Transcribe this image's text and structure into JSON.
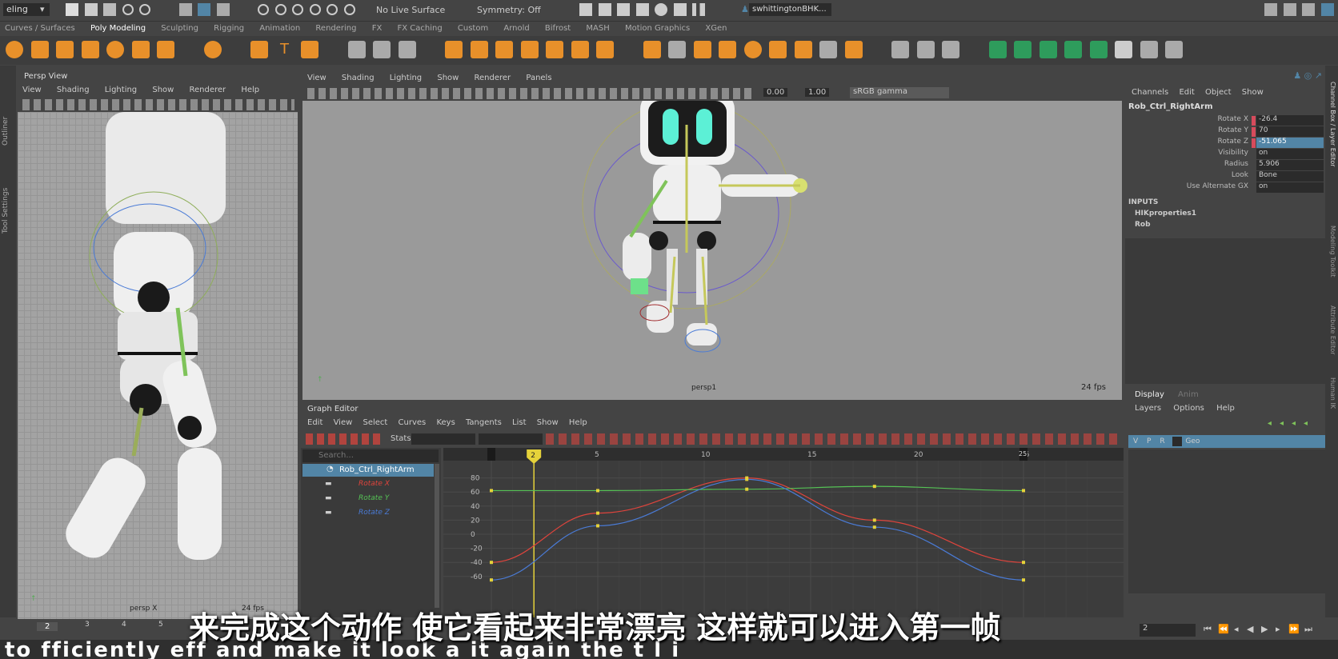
{
  "status_line": {
    "mode": "eling",
    "live_surface": "No Live Surface",
    "symmetry": "Symmetry: Off",
    "user": "swhittingtonBHK..."
  },
  "shelf_tabs": [
    "Curves / Surfaces",
    "Poly Modeling",
    "Sculpting",
    "Rigging",
    "Animation",
    "Rendering",
    "FX",
    "FX Caching",
    "Custom",
    "Arnold",
    "Bifrost",
    "MASH",
    "Motion Graphics",
    "XGen"
  ],
  "left_panel": {
    "title": "Persp View",
    "menu": [
      "View",
      "Shading",
      "Lighting",
      "Show",
      "Renderer",
      "Help"
    ],
    "camera": "persp X",
    "fps": "24 fps",
    "side_tabs": [
      "Outliner",
      "Tool Settings"
    ]
  },
  "main_view": {
    "menu": [
      "View",
      "Shading",
      "Lighting",
      "Show",
      "Renderer",
      "Panels"
    ],
    "exposure": "0.00",
    "gamma": "1.00",
    "colorspace": "sRGB gamma",
    "camera": "persp1",
    "fps": "24 fps"
  },
  "graph_editor": {
    "title": "Graph Editor",
    "menu": [
      "Edit",
      "View",
      "Select",
      "Curves",
      "Keys",
      "Tangents",
      "List",
      "Show",
      "Help"
    ],
    "stats_label": "Stats",
    "search_placeholder": "Search...",
    "outliner": {
      "node": "Rob_Ctrl_RightArm",
      "channels": [
        "Rotate X",
        "Rotate Y",
        "Rotate Z"
      ]
    },
    "frame_ticks": [
      "0",
      "5",
      "10",
      "15",
      "20",
      "25"
    ],
    "value_ticks": [
      "80",
      "60",
      "40",
      "20",
      "0",
      "-20",
      "-40",
      "-60"
    ],
    "current_frame": "2",
    "end_frame": "25"
  },
  "channel_box": {
    "menu": [
      "Channels",
      "Edit",
      "Object",
      "Show"
    ],
    "object": "Rob_Ctrl_RightArm",
    "attrs": [
      {
        "label": "Rotate X",
        "value": "-26.4"
      },
      {
        "label": "Rotate Y",
        "value": "70"
      },
      {
        "label": "Rotate Z",
        "value": "-51.065"
      },
      {
        "label": "Visibility",
        "value": "on"
      },
      {
        "label": "Radius",
        "value": "5.906"
      },
      {
        "label": "Look",
        "value": "Bone"
      },
      {
        "label": "Use Alternate GX",
        "value": "on"
      }
    ],
    "inputs_header": "INPUTS",
    "inputs": [
      "HIKproperties1",
      "Rob"
    ],
    "side_tabs": [
      "Channel Box / Layer Editor",
      "Modeling Toolkit",
      "Attribute Editor",
      "Human IK"
    ]
  },
  "layer_editor": {
    "tabs": [
      "Display",
      "Anim"
    ],
    "menu": [
      "Layers",
      "Options",
      "Help"
    ],
    "layer": {
      "v": "V",
      "p": "P",
      "r": "R",
      "name": "Geo"
    }
  },
  "timeline": {
    "current": "2",
    "frame_field": "2",
    "ticks": [
      "2",
      "3",
      "4",
      "5"
    ]
  },
  "subtitle": "来完成这个动作 使它看起来非常漂亮 这样就可以进入第一帧",
  "bottom_caption": "to fficiently eff and make it look a it again the t l i",
  "colors": {
    "accent": "#5285a6",
    "rotate_x": "#e0443c",
    "rotate_y": "#55c255",
    "rotate_z": "#4a7bd6",
    "key": "#e5d23a",
    "bg_view": "#9a9a9a"
  }
}
